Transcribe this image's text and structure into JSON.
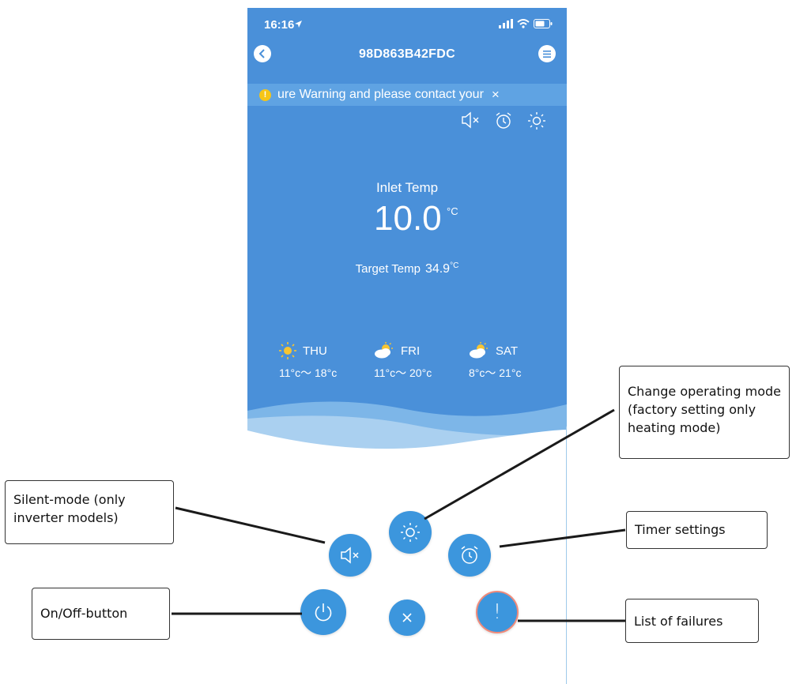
{
  "status_bar": {
    "time": "16:16"
  },
  "header": {
    "title": "98D863B42FDC"
  },
  "warning_banner": {
    "text": "ure Warning and please contact your",
    "close": "×"
  },
  "main": {
    "inlet_label": "Inlet Temp",
    "inlet_value": "10.0",
    "inlet_unit": "°C",
    "target_label": "Target Temp",
    "target_value": "34.9",
    "target_unit": "°C"
  },
  "forecast": [
    {
      "day": "THU",
      "range": "11°c～ 18°c",
      "icon": "sun-icon"
    },
    {
      "day": "FRI",
      "range": "11°c～ 20°c",
      "icon": "partly-cloudy-icon"
    },
    {
      "day": "SAT",
      "range": "8°c～ 21°c",
      "icon": "partly-cloudy-icon"
    }
  ],
  "buttons": {
    "close": "×",
    "failures": "!"
  },
  "callouts": {
    "operating_mode": "Change operating mode (factory setting only heating mode)",
    "silent_mode": "Silent-mode (only inverter models)",
    "timer": "Timer settings",
    "on_off": "On/Off-button",
    "failures": "List of failures"
  },
  "colors": {
    "primary_blue": "#4a90d9",
    "button_blue": "#3c96dd",
    "warning_yellow": "#f5c518",
    "failure_ring": "#f08a7a"
  }
}
